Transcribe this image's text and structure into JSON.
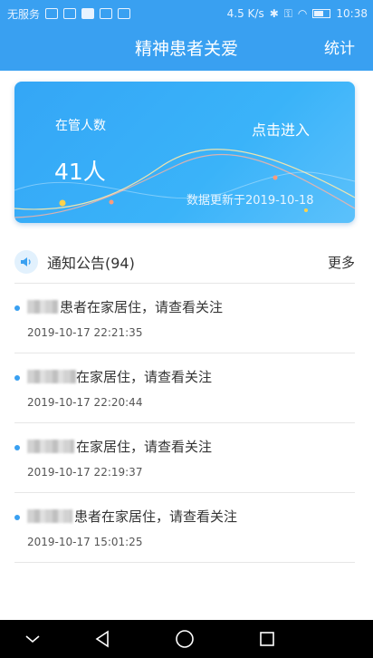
{
  "status_bar": {
    "carrier": "无服务",
    "speed": "4.5 K/s",
    "time": "10:38"
  },
  "header": {
    "title": "精神患者关爱",
    "right_action": "统计"
  },
  "summary_card": {
    "label": "在管人数",
    "count": "41人",
    "enter_link": "点击进入",
    "updated": "数据更新于2019-10-18"
  },
  "notices": {
    "icon": "speaker-icon",
    "title": "通知公告(94)",
    "more": "更多",
    "items": [
      {
        "text": "患者在家居住，请查看关注",
        "time": "2019-10-17 22:21:35"
      },
      {
        "text": "在家居住，请查看关注",
        "time": "2019-10-17 22:20:44"
      },
      {
        "text": "在家居住，请查看关注",
        "time": "2019-10-17 22:19:37"
      },
      {
        "text": "患者在家居住，请查看关注",
        "time": "2019-10-17 15:01:25"
      }
    ]
  },
  "colors": {
    "primary": "#39a0f1",
    "text": "#333333",
    "divider": "#e6e6e6"
  }
}
